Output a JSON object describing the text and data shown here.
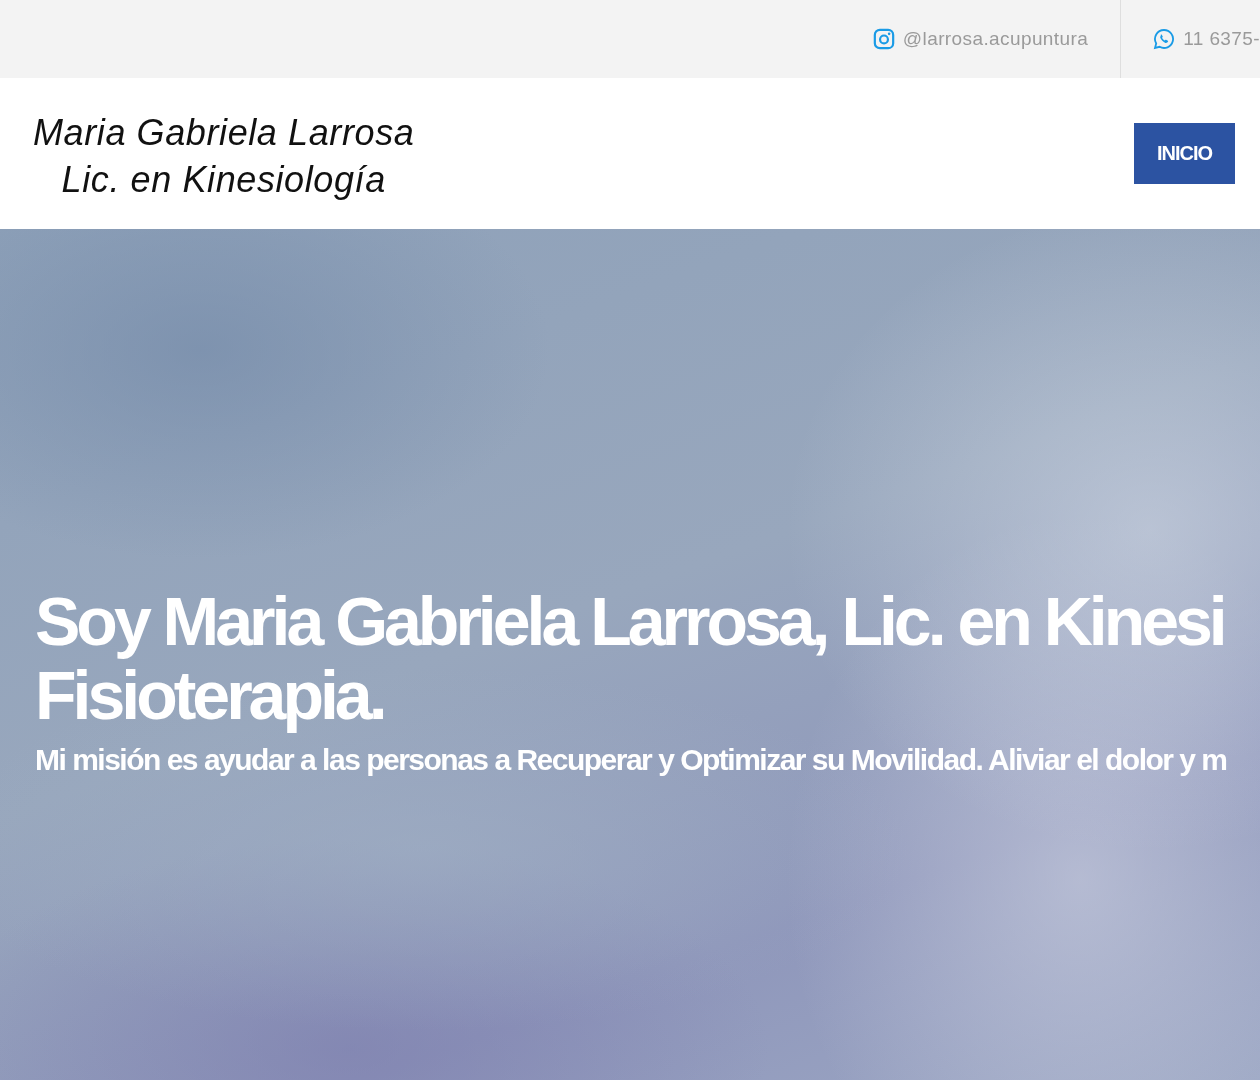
{
  "top_bar": {
    "contacts": [
      {
        "kind": "instagram",
        "text": "@larrosa.acupuntura"
      },
      {
        "kind": "whatsapp",
        "text": "11 6375-"
      }
    ]
  },
  "header": {
    "logo_lines": [
      "Maria Gabriela Larrosa",
      "Lic. en Kinesiología"
    ],
    "nav": [
      {
        "label": "INICIO",
        "selected": true
      }
    ]
  },
  "hero": {
    "title_lines": [
      "Soy Maria Gabriela Larrosa, Lic. en Kinesi",
      "Fisioterapia."
    ],
    "subtitle": "Mi misión es ayudar a las personas a Recuperar y Optimizar su Movilidad. Aliviar el dolor y m"
  }
}
